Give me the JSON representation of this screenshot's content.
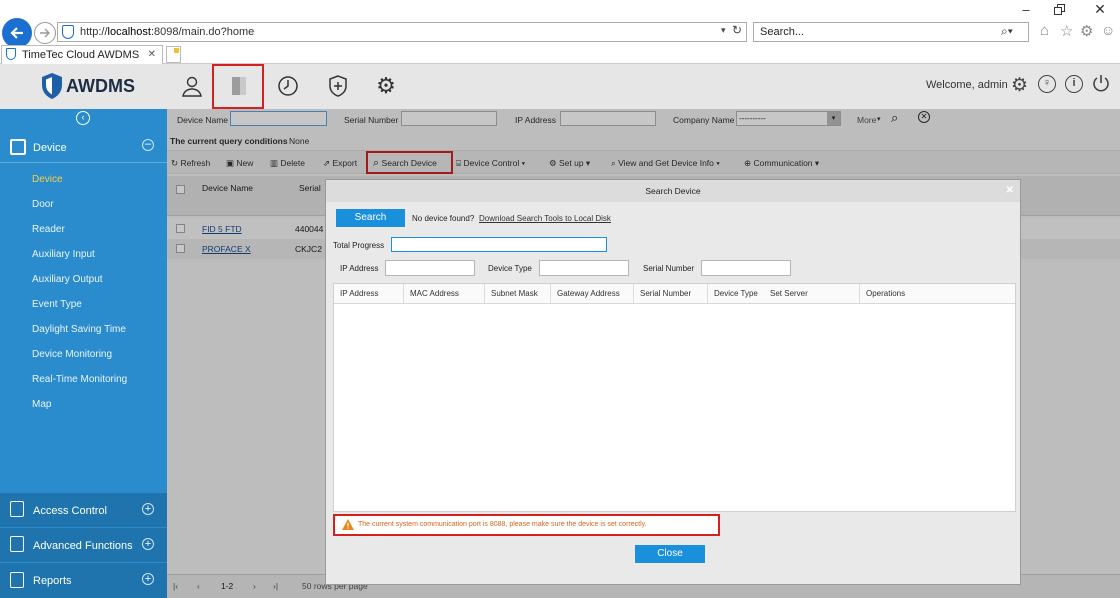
{
  "browser": {
    "url_prefix": "http://",
    "url_host": "localhost",
    "url_rest": ":8098/main.do?home",
    "search_placeholder": "Search...",
    "tab_title": "TimeTec Cloud AWDMS"
  },
  "app": {
    "logo": "AWDMS",
    "welcome": "Welcome, admin"
  },
  "sidebar": {
    "device_section": "Device",
    "items": [
      "Device",
      "Door",
      "Reader",
      "Auxiliary Input",
      "Auxiliary Output",
      "Event Type",
      "Daylight Saving Time",
      "Device Monitoring",
      "Real-Time Monitoring",
      "Map"
    ],
    "access_control": "Access Control",
    "advanced_functions": "Advanced Functions",
    "reports": "Reports"
  },
  "filter": {
    "device_name": "Device Name",
    "serial_number": "Serial Number",
    "ip_address": "IP Address",
    "company_name": "Company Name",
    "company_value": "----------",
    "more": "More",
    "query_label": "The current query conditions",
    "query_value": "None"
  },
  "toolbar": {
    "refresh": "Refresh",
    "new": "New",
    "delete": "Delete",
    "export": "Export",
    "search_device": "Search Device",
    "device_control": "Device Control",
    "setup": "Set up",
    "view_info": "View and Get Device Info",
    "communication": "Communication"
  },
  "grid": {
    "col_device_name": "Device Name",
    "col_serial": "Serial",
    "rows": [
      {
        "name": "FID 5 FTD",
        "serial": "440044"
      },
      {
        "name": "PROFACE X",
        "serial": "CKJC2"
      }
    ],
    "pager_page": "1-2",
    "pager_rows": "50 rows per page"
  },
  "modal": {
    "title": "Search Device",
    "search_button": "Search",
    "not_found": "No device found?",
    "download_link": "Download Search Tools to Local Disk",
    "total_progress": "Total Progress",
    "ip_address": "IP Address",
    "device_type": "Device Type",
    "serial_number": "Serial Number",
    "columns": [
      "IP Address",
      "MAC Address",
      "Subnet Mask",
      "Gateway Address",
      "Serial Number",
      "Device Type",
      "Set Server",
      "Operations"
    ],
    "warning": "The current system communication port is 8088, please make sure the device is set correctly.",
    "close_button": "Close"
  },
  "colors": {
    "sidebar": "#2a8ccc",
    "accent": "#1a8fdc",
    "warning": "#d9651b",
    "highlight": "#d32020"
  }
}
